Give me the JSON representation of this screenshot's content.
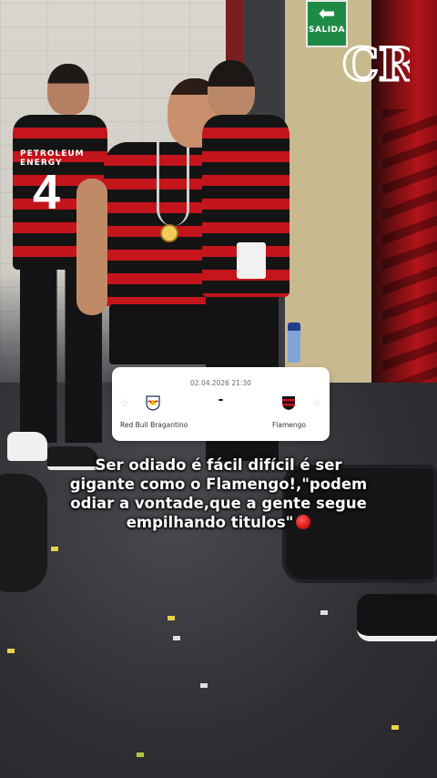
{
  "background": {
    "exit_sign": {
      "label": "SALIDA",
      "arrow": "⬅"
    },
    "club_logo": {
      "monogram": "CRF",
      "icon": "flamengo-crest-icon"
    },
    "jersey_name": "PETROLEUM ENERGY",
    "jersey_number": "4",
    "colors": {
      "red": "#c4141c",
      "black": "#141414",
      "exit_green": "#1f8a45"
    }
  },
  "score_card": {
    "datetime": "02.04.2026 21:30",
    "score": "-",
    "home_team": {
      "name": "Red Bull Bragantino",
      "logo_icon": "red-bull-bragantino-logo"
    },
    "away_team": {
      "name": "Flamengo",
      "logo_icon": "flamengo-crest-icon"
    },
    "star_icon": "☆"
  },
  "caption": {
    "line1": "Ser odiado é fácil difícil é ser",
    "line2": "gigante como o Flamengo!,\"podem",
    "line3": "odiar a vontade,que a gente segue",
    "line4": "empilhando titulos\"",
    "emoji": "red-circle-emoji"
  }
}
